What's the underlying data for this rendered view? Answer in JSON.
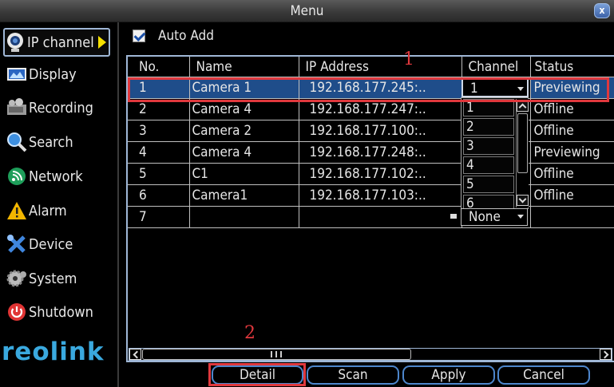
{
  "window": {
    "title": "Menu",
    "close_label": "x"
  },
  "sidebar": {
    "items": [
      {
        "label": "IP channel",
        "icon": "ip-camera-icon"
      },
      {
        "label": "Display",
        "icon": "display-icon"
      },
      {
        "label": "Recording",
        "icon": "recording-icon"
      },
      {
        "label": "Search",
        "icon": "search-icon"
      },
      {
        "label": "Network",
        "icon": "network-icon"
      },
      {
        "label": "Alarm",
        "icon": "alarm-icon"
      },
      {
        "label": "Device",
        "icon": "device-icon"
      },
      {
        "label": "System",
        "icon": "system-icon"
      },
      {
        "label": "Shutdown",
        "icon": "shutdown-icon"
      }
    ],
    "logo": "reolink"
  },
  "auto_add": {
    "label": "Auto Add",
    "checked": true
  },
  "table": {
    "columns": [
      "No.",
      "Name",
      "IP Address",
      "Channel",
      "Status"
    ],
    "rows": [
      {
        "no": "1",
        "name": "Camera 1",
        "ip": "192.168.177.245:..",
        "channel": "1",
        "status": "Previewing"
      },
      {
        "no": "2",
        "name": "Camera 4",
        "ip": "192.168.177.247:..",
        "channel": "",
        "status": "Offline"
      },
      {
        "no": "3",
        "name": "Camera 2",
        "ip": "192.168.177.100:..",
        "channel": "",
        "status": "Offline"
      },
      {
        "no": "4",
        "name": "Camera 4",
        "ip": "192.168.177.248:..",
        "channel": "",
        "status": "Previewing"
      },
      {
        "no": "5",
        "name": "C1",
        "ip": "192.168.177.102:..",
        "channel": "",
        "status": "Offline"
      },
      {
        "no": "6",
        "name": "Camera1",
        "ip": "192.168.177.103:..",
        "channel": "",
        "status": "Offline"
      },
      {
        "no": "7",
        "name": "",
        "ip": "",
        "channel": "None",
        "status": ""
      }
    ]
  },
  "channel_dropdown": {
    "options": [
      "1",
      "2",
      "3",
      "4",
      "5",
      "6"
    ]
  },
  "annotations": {
    "one": "1",
    "two": "2"
  },
  "buttons": {
    "detail": "Detail",
    "scan": "Scan",
    "apply": "Apply",
    "cancel": "Cancel"
  },
  "colors": {
    "accent": "#4d86cc",
    "selected_row": "#1f4d8a",
    "annotation": "#e0383d",
    "logo": "#3aa9df",
    "arrow": "#f5e000"
  }
}
